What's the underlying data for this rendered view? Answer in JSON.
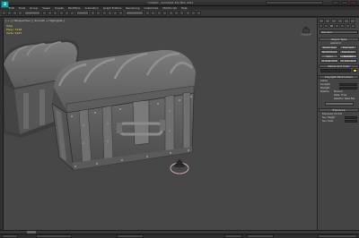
{
  "app": {
    "logo_text": "3"
  },
  "window": {
    "title": "Untitled - Autodesk 3ds Max 2011"
  },
  "menu": {
    "items": [
      "Edit",
      "Tools",
      "Group",
      "Views",
      "Create",
      "Modifiers",
      "Animation",
      "Graph Editors",
      "Rendering",
      "Customize",
      "MAXScript",
      "Help"
    ]
  },
  "viewport": {
    "label": "[ + ] [ Perspective ] [ Smooth + Highlights ]",
    "stats": {
      "total_label": "Total",
      "polys_label": "Polys:",
      "polys_value": "5238",
      "verts_label": "Verts:",
      "verts_value": "5287"
    }
  },
  "command_panel": {
    "dropdown_value": "Standard",
    "object_type_header": "Object Type",
    "autogrid_label": "AutoGrid",
    "buttons": [
      "Target Spot",
      "Free Spot",
      "Target Direct",
      "Free Direct",
      "Omni",
      "Skylight",
      "mr Area Omni",
      "mr Area Spot"
    ],
    "name_color_header": "Name and Color",
    "daylight_header": "Daylight Parameters",
    "daylight_labels": [
      "Active",
      "Sunlight",
      "Skylight",
      "Position",
      "Manual",
      "Date, Time",
      "Weather Data File"
    ],
    "override_header": "Exposure",
    "override_labels": [
      "Exposure Control",
      "Sun Height",
      "Sun Color"
    ]
  },
  "colors": {
    "accent": "#16a3a8",
    "viewport_bg": "#474747",
    "stats_text": "#e6d84a",
    "name_swatch": "#e8c93a"
  }
}
